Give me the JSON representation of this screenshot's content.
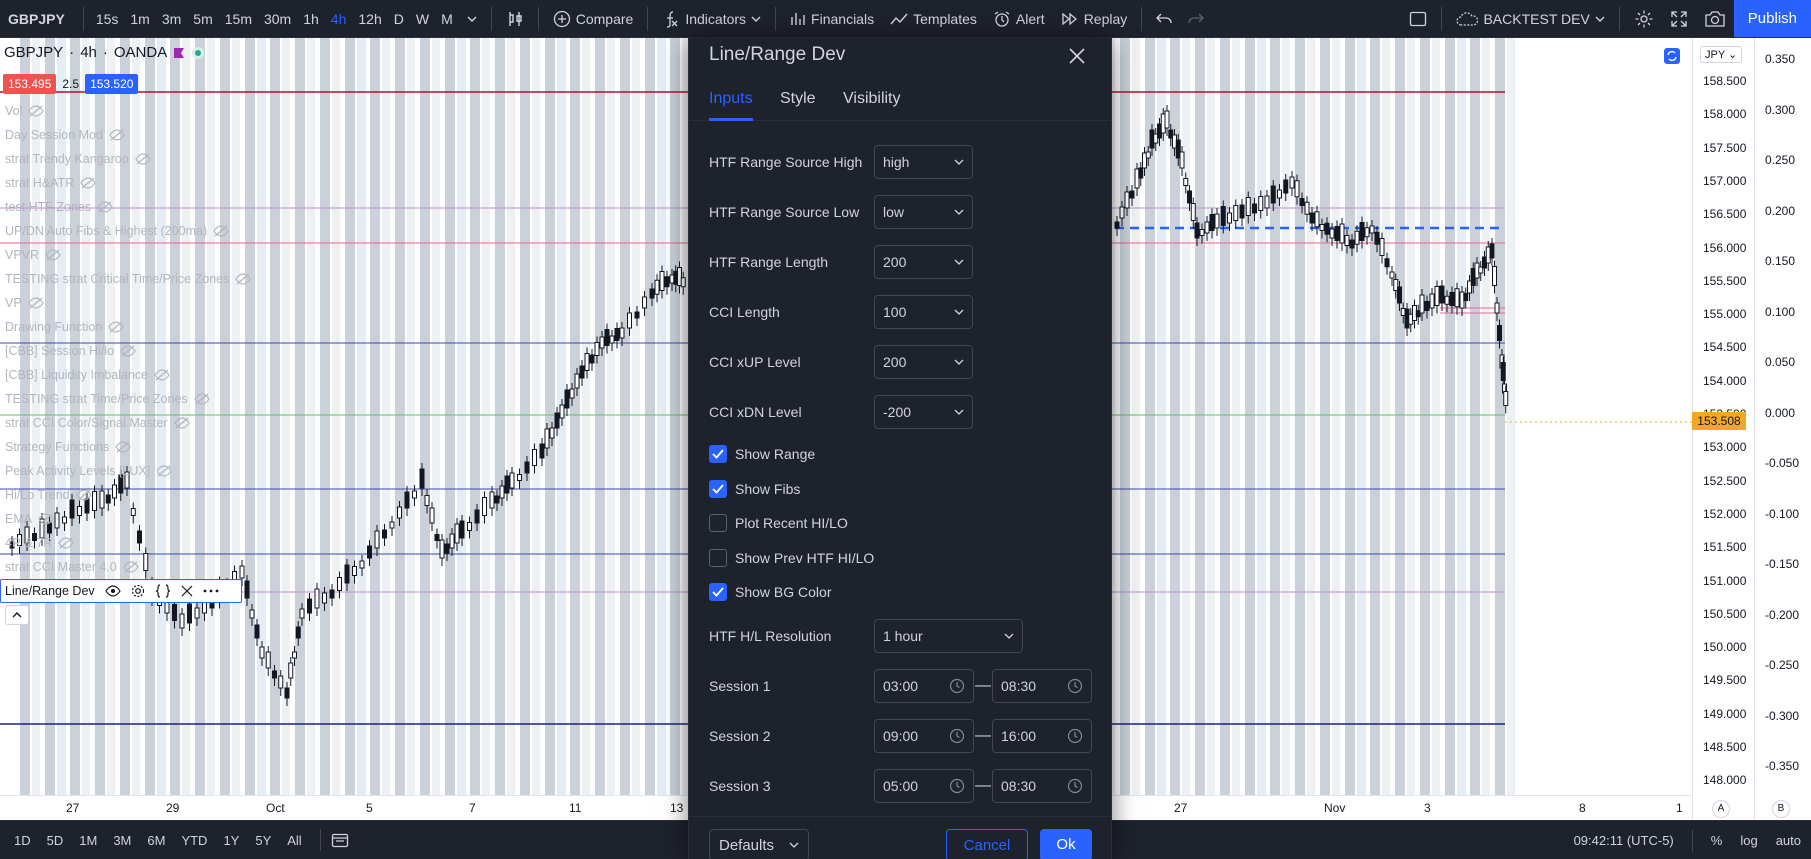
{
  "topbar": {
    "symbol": "GBPJPY",
    "timeframes": [
      "15s",
      "1m",
      "3m",
      "5m",
      "15m",
      "30m",
      "1h",
      "4h",
      "12h",
      "D",
      "W",
      "M"
    ],
    "active_timeframe": "4h",
    "compare_label": "Compare",
    "indicators_label": "Indicators",
    "financials_label": "Financials",
    "templates_label": "Templates",
    "alert_label": "Alert",
    "replay_label": "Replay",
    "layout_name": "BACKTEST DEV",
    "publish_label": "Publish"
  },
  "legend": {
    "symbol": "GBPJPY",
    "interval": "4h",
    "broker": "OANDA",
    "bid": "153.495",
    "spread": "2.5",
    "ask": "153.520",
    "indicators": [
      "Vol",
      "Day Session Mod",
      "strat Trendy Kangaroo",
      "strat H&ATR",
      "test HTF Zones",
      "UP/DN Auto Fibs & Highest (200ma)",
      "VPVR",
      "TESTING strat Critical Time/Price Zones",
      "VP",
      "Drawing Function",
      "[CBB] Session Hi/lo",
      "[CBB] Liquidity Imbalance",
      "TESTING strat Time/Price Zones",
      "strat CCI Color/Signal Master",
      "Strategy Functions",
      "Peak Activity Levels [LUX]",
      "Hi/Lo Trend",
      "EMA",
      "4R & 7R",
      "strat CCI Master 4.0"
    ],
    "selected_indicator": "Line/Range Dev"
  },
  "price_axis": {
    "currency": "JPY",
    "ticks": [
      "158.500",
      "158.000",
      "157.500",
      "157.000",
      "156.500",
      "156.000",
      "155.500",
      "155.000",
      "154.500",
      "154.000",
      "153.500",
      "153.000",
      "152.500",
      "152.000",
      "151.500",
      "151.000",
      "150.500",
      "150.000",
      "149.500",
      "149.000",
      "148.500",
      "148.000"
    ],
    "last_price": "153.508"
  },
  "osc_axis": {
    "ticks": [
      "0.350",
      "0.300",
      "0.250",
      "0.200",
      "0.150",
      "0.100",
      "0.050",
      "0.000",
      "-0.050",
      "-0.100",
      "-0.150",
      "-0.200",
      "-0.250",
      "-0.300",
      "-0.350"
    ]
  },
  "time_axis": {
    "labels": [
      "27",
      "29",
      "Oct",
      "5",
      "7",
      "11",
      "13",
      "27",
      "Nov",
      "3",
      "8",
      "1"
    ]
  },
  "bottombar": {
    "ranges": [
      "1D",
      "5D",
      "1M",
      "3M",
      "6M",
      "YTD",
      "1Y",
      "5Y",
      "All"
    ],
    "clock": "09:42:11 (UTC-5)",
    "percent_label": "%",
    "log_label": "log",
    "auto_label": "auto",
    "scale_a": "A",
    "scale_b": "B"
  },
  "dialog": {
    "title": "Line/Range Dev",
    "tabs": [
      "Inputs",
      "Style",
      "Visibility"
    ],
    "active_tab": "Inputs",
    "fields": [
      {
        "label": "HTF Range Source High",
        "value": "high"
      },
      {
        "label": "HTF Range Source Low",
        "value": "low"
      },
      {
        "label": "HTF Range Length",
        "value": "200"
      },
      {
        "label": "CCI Length",
        "value": "100"
      },
      {
        "label": "CCI xUP Level",
        "value": "200"
      },
      {
        "label": "CCI xDN Level",
        "value": "-200"
      }
    ],
    "checkboxes": [
      {
        "label": "Show Range",
        "checked": true
      },
      {
        "label": "Show Fibs",
        "checked": true
      },
      {
        "label": "Plot Recent HI/LO",
        "checked": false
      },
      {
        "label": "Show Prev HTF HI/LO",
        "checked": false
      },
      {
        "label": "Show BG Color",
        "checked": true
      }
    ],
    "resolution": {
      "label": "HTF H/L Resolution",
      "value": "1 hour"
    },
    "sessions": [
      {
        "label": "Session 1",
        "start": "03:00",
        "end": "08:30"
      },
      {
        "label": "Session 2",
        "start": "09:00",
        "end": "16:00"
      },
      {
        "label": "Session 3",
        "start": "05:00",
        "end": "08:30"
      }
    ],
    "session_separator": "—",
    "defaults_label": "Defaults",
    "cancel_label": "Cancel",
    "ok_label": "Ok"
  },
  "colors": {
    "accent": "#2962ff",
    "dialog_bg": "#1e222d",
    "topbar_bg": "#1e222d",
    "candle": "#000000",
    "stripe_grey": "#b8c2cc",
    "stripe_blue": "#dce8f5",
    "last_price_bg": "#f5a623",
    "bid_red": "#ef5350"
  }
}
